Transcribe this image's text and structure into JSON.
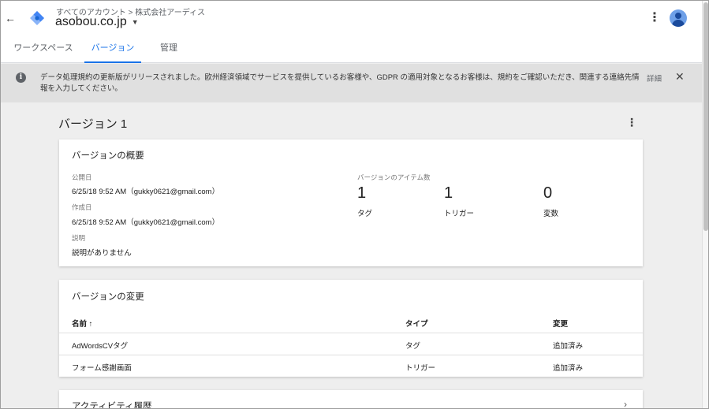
{
  "header": {
    "breadcrumb": "すべてのアカウント > 株式会社アーディス",
    "container_name": "asobou.co.jp",
    "back_icon": "arrow-left-icon",
    "logo_icon": "gtm-diamond-logo",
    "more_icon": "more-vert-icon",
    "avatar_icon": "account-avatar-icon"
  },
  "tabs": [
    {
      "label": "ワークスペース",
      "active": false
    },
    {
      "label": "バージョン",
      "active": true
    },
    {
      "label": "管理",
      "active": false
    }
  ],
  "banner": {
    "text": "データ処理規約の更新版がリリースされました。欧州経済領域でサービスを提供しているお客様や、GDPR の適用対象となるお客様は、規約をご確認いただき、関連する連絡先情報を入力してください。",
    "link_label": "詳細",
    "info_icon": "info-icon",
    "close_icon": "close-icon"
  },
  "page": {
    "title": "バージョン 1"
  },
  "overview": {
    "title": "バージョンの概要",
    "published_label": "公開日",
    "published_value": "6/25/18 9:52 AM（gukky0621@gmail.com）",
    "created_label": "作成日",
    "created_value": "6/25/18 9:52 AM（gukky0621@gmail.com）",
    "description_label": "説明",
    "description_value": "説明がありません",
    "items_label": "バージョンのアイテム数",
    "counts": [
      {
        "number": "1",
        "label": "タグ"
      },
      {
        "number": "1",
        "label": "トリガー"
      },
      {
        "number": "0",
        "label": "変数"
      }
    ]
  },
  "changes": {
    "title": "バージョンの変更",
    "columns": {
      "name": "名前",
      "sort_icon": "arrow-up-icon",
      "type": "タイプ",
      "change": "変更"
    },
    "rows": [
      {
        "name": "AdWordsCVタグ",
        "type": "タグ",
        "change": "追加済み"
      },
      {
        "name": "フォーム感謝画面",
        "type": "トリガー",
        "change": "追加済み"
      }
    ]
  },
  "activity": {
    "title": "アクティビティ履歴",
    "chevron_icon": "chevron-right-icon"
  }
}
